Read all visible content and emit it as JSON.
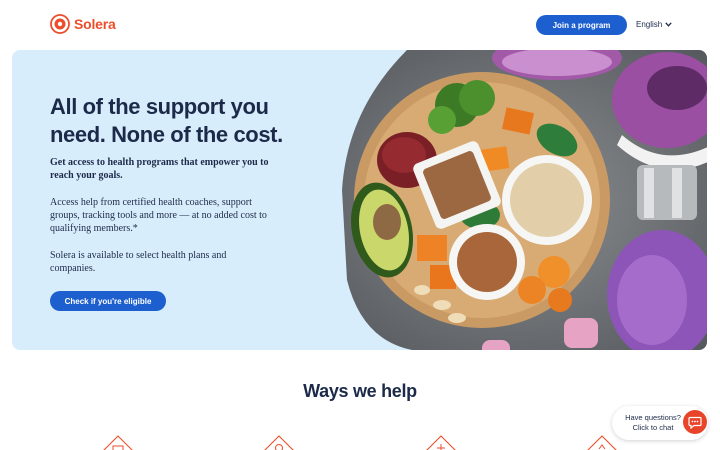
{
  "header": {
    "brand": "Solera",
    "join_button": "Join a program",
    "language": "English"
  },
  "hero": {
    "title": "All of the support you need. None of the cost.",
    "subtitle": "Get access to health programs that empower you to reach your goals.",
    "paragraph_1": "Access help from certified health coaches, support groups, tracking tools and more — at no added cost to qualifying members.*",
    "paragraph_2": "Solera is available to select health plans and companies.",
    "cta": "Check if you're eligible"
  },
  "ways": {
    "title": "Ways we help",
    "icons": [
      "coaching-icon",
      "location-icon",
      "tracking-icon",
      "wellness-icon"
    ]
  },
  "chat": {
    "line_1": "Have questions?",
    "line_2": "Click to chat"
  },
  "colors": {
    "brand_orange": "#ec4e2b",
    "primary_blue": "#1d5fcf",
    "hero_bg": "#d8edfb",
    "text_navy": "#1c2a4a"
  }
}
